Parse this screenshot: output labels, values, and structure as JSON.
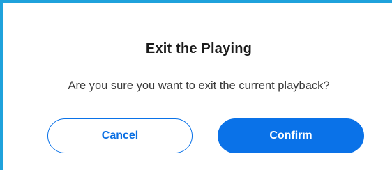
{
  "dialog": {
    "title": "Exit the Playing",
    "message": "Are you sure you want to exit the current playback?",
    "cancel_label": "Cancel",
    "confirm_label": "Confirm"
  },
  "colors": {
    "accent": "#0a72e8",
    "frame_border": "#1fa2dc",
    "title_text": "#1b1b1b",
    "body_text": "#3a3a3a"
  }
}
